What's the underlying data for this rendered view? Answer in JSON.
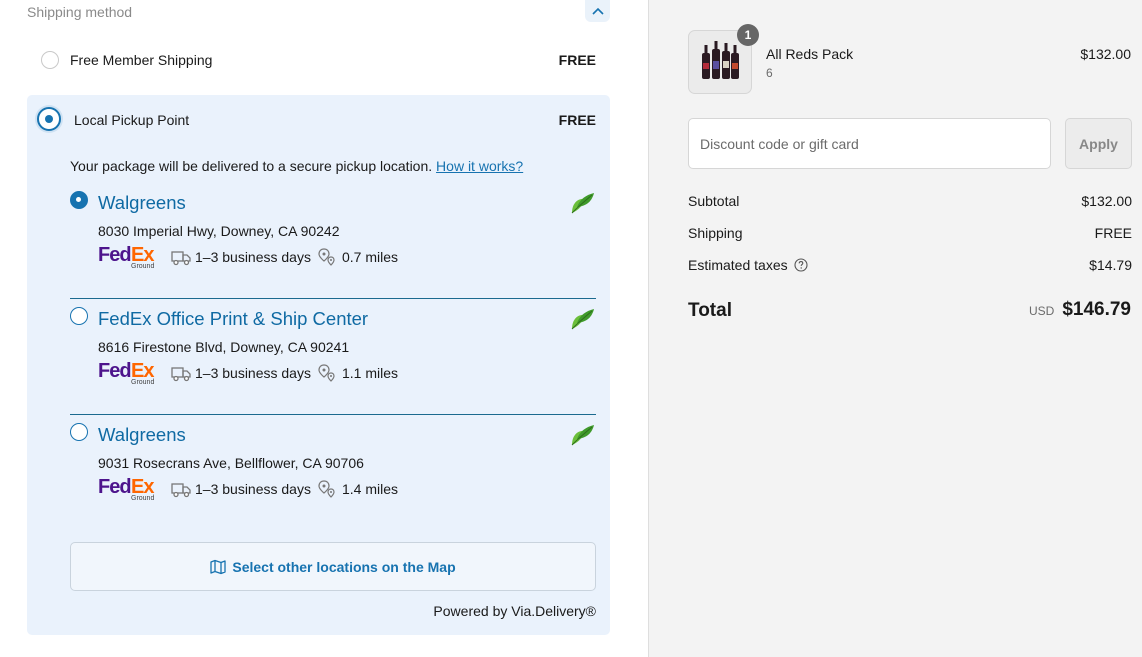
{
  "shipping": {
    "section_title": "Shipping method",
    "options": [
      {
        "label": "Free Member Shipping",
        "price": "FREE",
        "selected": false
      },
      {
        "label": "Local Pickup Point",
        "price": "FREE",
        "selected": true
      }
    ]
  },
  "pickup": {
    "intro_text": "Your package will be delivered to a secure pickup location.",
    "how_link": "How it works?",
    "locations": [
      {
        "name": "Walgreens",
        "address": "8030 Imperial Hwy, Downey, CA 90242",
        "delivery": "1–3 business days",
        "distance": "0.7 miles",
        "selected": true
      },
      {
        "name": "FedEx Office Print & Ship Center",
        "address": "8616 Firestone Blvd, Downey, CA 90241",
        "delivery": "1–3 business days",
        "distance": "1.1 miles",
        "selected": false
      },
      {
        "name": "Walgreens",
        "address": "9031 Rosecrans Ave, Bellflower, CA 90706",
        "delivery": "1–3 business days",
        "distance": "1.4 miles",
        "selected": false
      }
    ],
    "carrier_logo": {
      "left": "Fed",
      "right": "Ex",
      "sub": "Ground"
    },
    "map_button": "Select other locations on the Map",
    "powered_by": "Powered by Via.Delivery®"
  },
  "summary": {
    "item": {
      "name": "All Reds Pack",
      "variant": "6",
      "price": "$132.00",
      "quantity": "1"
    },
    "discount_placeholder": "Discount code or gift card",
    "apply_label": "Apply",
    "subtotal_label": "Subtotal",
    "subtotal_value": "$132.00",
    "shipping_label": "Shipping",
    "shipping_value": "FREE",
    "taxes_label": "Estimated taxes",
    "taxes_value": "$14.79",
    "total_label": "Total",
    "total_currency": "USD",
    "total_value": "$146.79"
  },
  "colors": {
    "accent": "#1773b0",
    "location_name": "#0f6aa3",
    "pickup_bg": "#eaf2fc",
    "fedex_purple": "#4d148c",
    "fedex_orange": "#ff6600"
  }
}
